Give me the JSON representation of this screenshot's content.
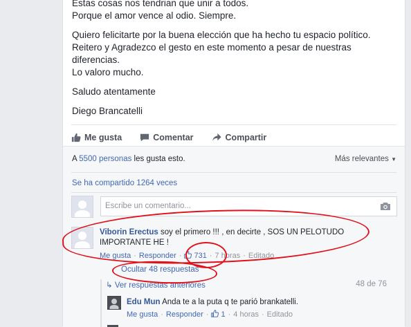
{
  "post": {
    "line1": "Estas cosas nos tendrian que unir a todos.",
    "line2": "Porque el amor vence al odio. Siempre.",
    "para2_l1": "Quiero felicitarte por la buena elección que ha hecho tu espacio político.",
    "para2_l2": "Reitero y Agradezco el gesto en este momento a pesar de nuestras",
    "para2_l3": "diferencias.",
    "para2_l4": "Lo valoro mucho.",
    "greeting": "Saludo atentamente",
    "signature": "Diego Brancatelli"
  },
  "actions": {
    "like": "Me gusta",
    "comment": "Comentar",
    "share": "Compartir"
  },
  "likes": {
    "prefix": "A",
    "count_people": "5500 personas",
    "suffix": "les gusta esto."
  },
  "sort": {
    "label": "Más relevantes"
  },
  "shared": {
    "text": "Se ha compartido 1264 veces"
  },
  "composer": {
    "placeholder": "Escribe un comentario..."
  },
  "comment1": {
    "author": "Viborin Erectus",
    "text": "soy el primero !!! , en decirte , SOS UN PELOTUDO IMPORTANTE HE !",
    "like": "Me gusta",
    "reply": "Responder",
    "likes": "731",
    "time": "7 horas",
    "edited": "Editado"
  },
  "replies": {
    "hide": "Ocultar 48 respuestas",
    "previous": "Ver respuestas anteriores",
    "count": "48 de 76"
  },
  "reply1": {
    "author": "Edu Mun",
    "text": "Anda te a la puta q te parió brankatelli.",
    "like": "Me gusta",
    "reply": "Responder",
    "likes": "1",
    "time": "4 horas",
    "edited": "Editado"
  },
  "colors": {
    "link": "#4267b2",
    "annotation": "#e0111b",
    "background": "#e9ebee"
  }
}
